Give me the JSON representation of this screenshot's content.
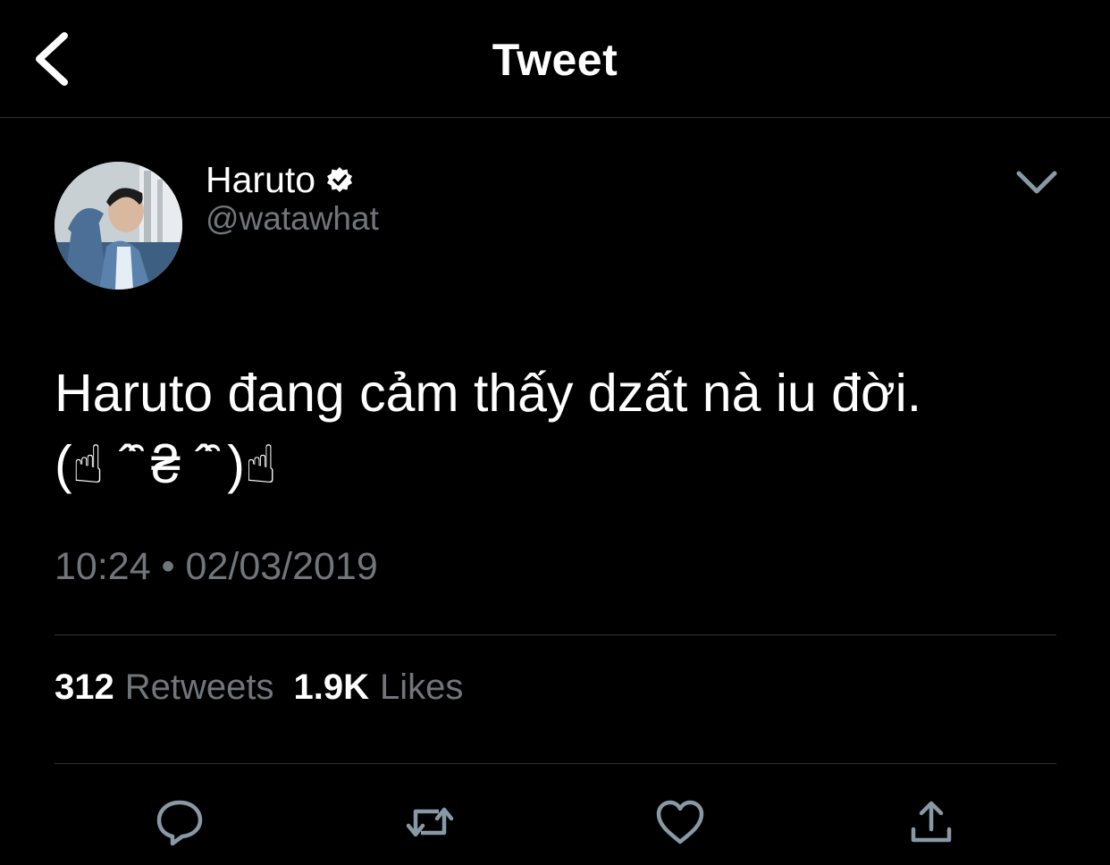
{
  "header": {
    "title": "Tweet",
    "back_icon": "chevron-left-icon"
  },
  "author": {
    "display_name": "Haruto",
    "username": "@watawhat",
    "verified": true
  },
  "tweet": {
    "text_line1": "Haruto đang cảm thấy dzất nà iu đời.",
    "text_line2": "(☝ ˆ̑ ₴ ˆ̑ )☝",
    "timestamp": "10:24 • 02/03/2019"
  },
  "stats": {
    "retweets_count": "312",
    "retweets_label": "Retweets",
    "likes_count": "1.9K",
    "likes_label": "Likes"
  },
  "actions": [
    "reply-icon",
    "retweet-icon",
    "like-icon",
    "share-icon"
  ],
  "colors": {
    "background": "#000000",
    "text_primary": "#ffffff",
    "text_secondary": "#71767b",
    "divider": "#2f3336",
    "icon": "#8899a6"
  }
}
